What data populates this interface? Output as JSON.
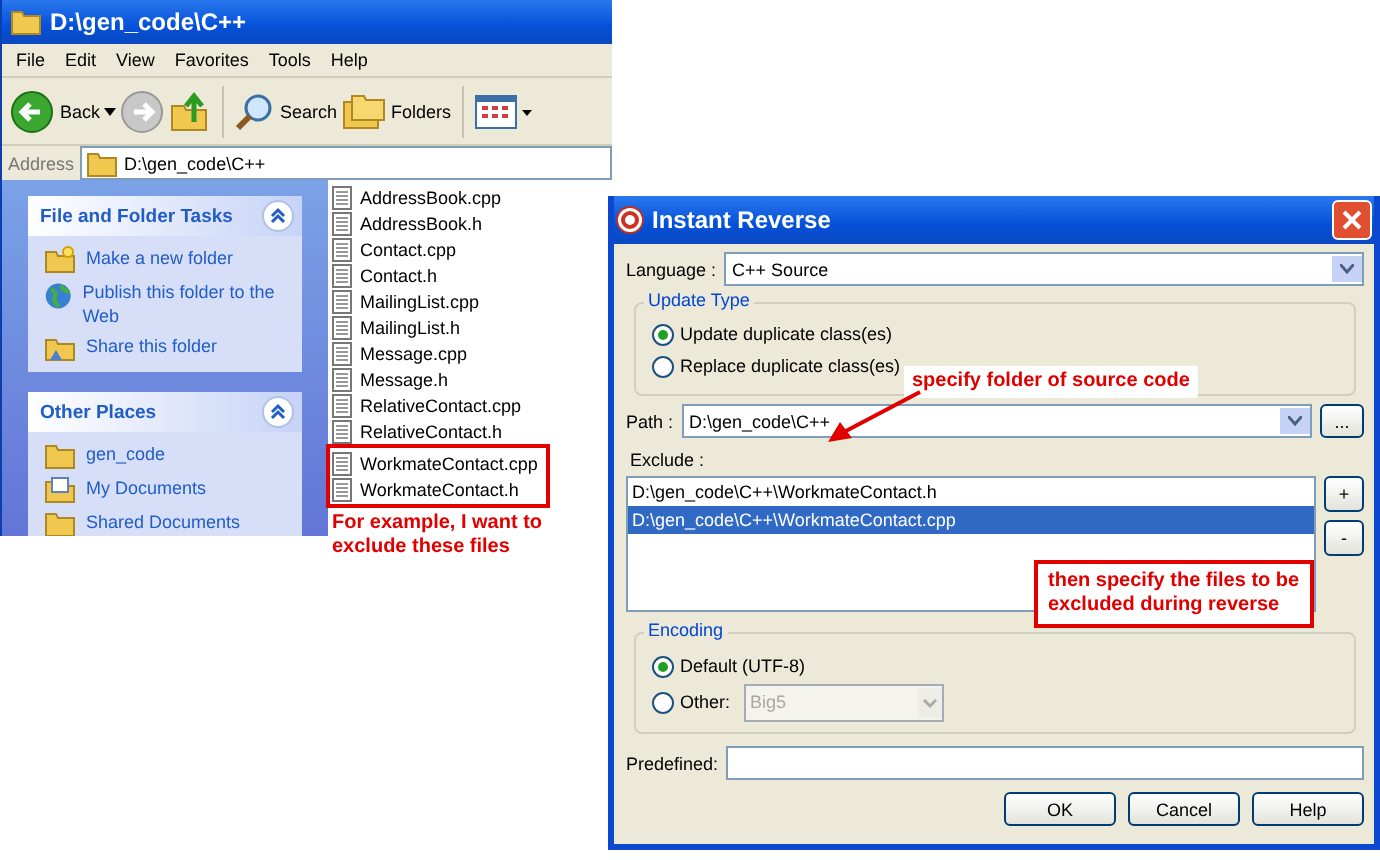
{
  "explorer": {
    "title": "D:\\gen_code\\C++",
    "menu": [
      "File",
      "Edit",
      "View",
      "Favorites",
      "Tools",
      "Help"
    ],
    "toolbar": [
      {
        "kind": "back",
        "label": "Back"
      },
      {
        "kind": "forward"
      },
      {
        "kind": "up"
      },
      {
        "kind": "search",
        "label": "Search"
      },
      {
        "kind": "folders",
        "label": "Folders"
      },
      {
        "kind": "views"
      }
    ],
    "address": {
      "label": "Address",
      "value": "D:\\gen_code\\C++"
    },
    "task_panels": [
      {
        "title": "File and Folder Tasks",
        "items": [
          {
            "kind": "new-folder",
            "label": "Make a new folder"
          },
          {
            "kind": "publish",
            "label": "Publish this folder to the Web"
          },
          {
            "kind": "share",
            "label": "Share this folder"
          }
        ]
      },
      {
        "title": "Other Places",
        "items": [
          {
            "kind": "folder",
            "label": "gen_code"
          },
          {
            "kind": "documents",
            "label": "My Documents"
          },
          {
            "kind": "folder",
            "label": "Shared Documents"
          }
        ]
      }
    ],
    "files": [
      {
        "name": "AddressBook.cpp",
        "highlighted": false
      },
      {
        "name": "AddressBook.h",
        "highlighted": false
      },
      {
        "name": "Contact.cpp",
        "highlighted": false
      },
      {
        "name": "Contact.h",
        "highlighted": false
      },
      {
        "name": "MailingList.cpp",
        "highlighted": false
      },
      {
        "name": "MailingList.h",
        "highlighted": false
      },
      {
        "name": "Message.cpp",
        "highlighted": false
      },
      {
        "name": "Message.h",
        "highlighted": false
      },
      {
        "name": "RelativeContact.cpp",
        "highlighted": false
      },
      {
        "name": "RelativeContact.h",
        "highlighted": false
      },
      {
        "name": "WorkmateContact.cpp",
        "highlighted": true
      },
      {
        "name": "WorkmateContact.h",
        "highlighted": true
      }
    ]
  },
  "dialog": {
    "title": "Instant Reverse",
    "language": {
      "label": "Language :",
      "value": "C++ Source"
    },
    "update_type": {
      "title": "Update Type",
      "options": [
        {
          "label": "Update duplicate class(es)",
          "selected": true
        },
        {
          "label": "Replace duplicate class(es)",
          "selected": false
        }
      ]
    },
    "path": {
      "label": "Path :",
      "value": "D:\\gen_code\\C++",
      "browse": "..."
    },
    "exclude": {
      "label": "Exclude :",
      "items": [
        {
          "path": "D:\\gen_code\\C++\\WorkmateContact.h",
          "selected": false
        },
        {
          "path": "D:\\gen_code\\C++\\WorkmateContact.cpp",
          "selected": true
        }
      ],
      "add": "+",
      "remove": "-"
    },
    "encoding": {
      "title": "Encoding",
      "options": [
        {
          "label": "Default (UTF-8)",
          "selected": true
        },
        {
          "label": "Other:",
          "selected": false,
          "value": "Big5",
          "disabled": true
        }
      ]
    },
    "predefined": {
      "label": "Predefined:"
    },
    "buttons": [
      "OK",
      "Cancel",
      "Help"
    ]
  },
  "annotations": {
    "files_note": "For example, I want to exclude these files",
    "path_note": "specify folder of source code",
    "exclude_note": "then specify the files to be excluded during reverse"
  }
}
